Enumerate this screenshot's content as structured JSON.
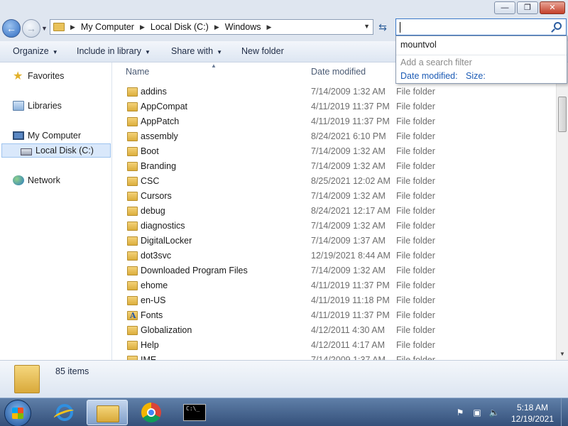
{
  "window": {
    "minimize_glyph": "—",
    "maximize_glyph": "❐",
    "close_glyph": "✕"
  },
  "address": {
    "breadcrumbs": [
      "My Computer",
      "Local Disk (C:)",
      "Windows"
    ]
  },
  "search": {
    "value": "",
    "history": [
      "mountvol"
    ],
    "hint": "Add a search filter",
    "filters": [
      "Date modified:",
      "Size:"
    ]
  },
  "toolbar": {
    "organize": "Organize",
    "include_in_library": "Include in library",
    "share_with": "Share with",
    "new_folder": "New folder"
  },
  "navpane": {
    "favorites": "Favorites",
    "libraries": "Libraries",
    "my_computer": "My Computer",
    "local_disk": "Local Disk (C:)",
    "network": "Network"
  },
  "columns": {
    "name": "Name",
    "date_modified": "Date modified"
  },
  "files": [
    {
      "name": "addins",
      "date": "7/14/2009 1:32 AM",
      "type": "File folder"
    },
    {
      "name": "AppCompat",
      "date": "4/11/2019 11:37 PM",
      "type": "File folder"
    },
    {
      "name": "AppPatch",
      "date": "4/11/2019 11:37 PM",
      "type": "File folder"
    },
    {
      "name": "assembly",
      "date": "8/24/2021 6:10 PM",
      "type": "File folder"
    },
    {
      "name": "Boot",
      "date": "7/14/2009 1:32 AM",
      "type": "File folder"
    },
    {
      "name": "Branding",
      "date": "7/14/2009 1:32 AM",
      "type": "File folder"
    },
    {
      "name": "CSC",
      "date": "8/25/2021 12:02 AM",
      "type": "File folder"
    },
    {
      "name": "Cursors",
      "date": "7/14/2009 1:32 AM",
      "type": "File folder"
    },
    {
      "name": "debug",
      "date": "8/24/2021 12:17 AM",
      "type": "File folder"
    },
    {
      "name": "diagnostics",
      "date": "7/14/2009 1:32 AM",
      "type": "File folder"
    },
    {
      "name": "DigitalLocker",
      "date": "7/14/2009 1:37 AM",
      "type": "File folder"
    },
    {
      "name": "dot3svc",
      "date": "12/19/2021 8:44 AM",
      "type": "File folder"
    },
    {
      "name": "Downloaded Program Files",
      "date": "7/14/2009 1:32 AM",
      "type": "File folder"
    },
    {
      "name": "ehome",
      "date": "4/11/2019 11:37 PM",
      "type": "File folder"
    },
    {
      "name": "en-US",
      "date": "4/11/2019 11:18 PM",
      "type": "File folder"
    },
    {
      "name": "Fonts",
      "date": "4/11/2019 11:37 PM",
      "type": "File folder",
      "icon": "fonts-folder-icon"
    },
    {
      "name": "Globalization",
      "date": "4/12/2011 4:30 AM",
      "type": "File folder"
    },
    {
      "name": "Help",
      "date": "4/12/2011 4:17 AM",
      "type": "File folder"
    },
    {
      "name": "IME",
      "date": "7/14/2009 1:37 AM",
      "type": "File folder"
    }
  ],
  "details": {
    "item_count": "85 items"
  },
  "taskbar": {
    "apps": [
      "internet-explorer",
      "windows-explorer",
      "google-chrome",
      "command-prompt"
    ],
    "cmd_glyph": "C:\\_",
    "tray_flag": "⚑",
    "tray_network": "▣",
    "tray_volume": "🔈",
    "time": "5:18 AM",
    "date": "12/19/2021"
  }
}
